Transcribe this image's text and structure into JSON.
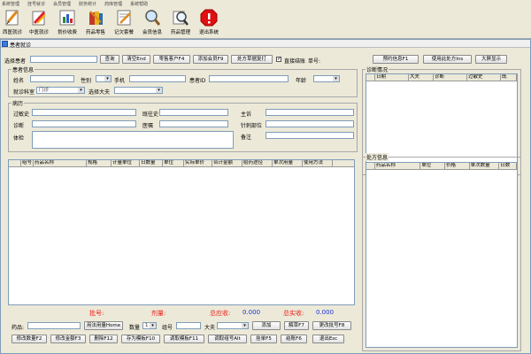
{
  "menu": [
    "系统管理",
    "挂号就诊",
    "会员管理",
    "财务统计",
    "药库管理",
    "系统帮助"
  ],
  "toolbar": [
    {
      "label": "西医就诊",
      "icon": "pencil-doc-icon"
    },
    {
      "label": "中医就诊",
      "icon": "pen-icon"
    },
    {
      "label": "划价收费",
      "icon": "chart-icon"
    },
    {
      "label": "药品零售",
      "icon": "books-icon"
    },
    {
      "label": "记欠套餐",
      "icon": "pencil-paper-icon"
    },
    {
      "label": "会员信息",
      "icon": "search-icon"
    },
    {
      "label": "药品管理",
      "icon": "magnifier-icon"
    },
    {
      "label": "退出系统",
      "icon": "exit-icon"
    }
  ],
  "window_title": "患者就诊",
  "top": {
    "select_patient": "选择患者",
    "query": "查询",
    "clear": "清空End",
    "walkin": "零售客户F4",
    "add_member": "添加会员F9",
    "prescription_tpl": "处方草据复打",
    "direct_settle": "直接结账",
    "bill_no": "单号:",
    "booking_info": "预约信息F1",
    "use_prescription": "使用此处方Ins",
    "big_screen": "大屏显示"
  },
  "patient": {
    "group": "患者信息",
    "name": "姓名",
    "gender": "性别",
    "phone": "手机",
    "patient_id": "患者ID",
    "age": "年龄",
    "dept": "就诊科室",
    "dept_value": "门诊",
    "doctor": "选择大夫"
  },
  "record": {
    "group": "病历",
    "past": "过敏史",
    "history": "既往史",
    "complaint": "主诉",
    "diagnosis": "诊断",
    "advice": "医嘱",
    "acupoint": "针刺部位",
    "exam": "体检",
    "remark": "备注"
  },
  "diag": {
    "group": "诊断情况",
    "cols": [
      "日期",
      "大夫",
      "诊断",
      "过敏史",
      "既"
    ]
  },
  "rx": {
    "group": "处方信息",
    "cols": [
      "药品名称",
      "单位",
      "价格",
      "单次数量",
      "日数"
    ]
  },
  "main_grid_cols": [
    "组号",
    "药品名称",
    "规格",
    "计量单位",
    "日数量",
    "单位",
    "实际单价",
    "合计金额",
    "给药途径",
    "单次用量",
    "使用方法"
  ],
  "bottom": {
    "batch_label": "批号:",
    "dose_label": "剂量:",
    "due_label": "总应收:",
    "due_value": "0.000",
    "paid_label": "总实收:",
    "paid_value": "0.000",
    "drug": "药品:",
    "usage_btn": "用法用量Home",
    "qty": "数量",
    "qty_val": "1",
    "group_no": "组号",
    "doctor": "大夫",
    "add": "添加",
    "decode": "解草F7",
    "change_batch": "更改批号F8",
    "b1": "修改数量F2",
    "b2": "修改金额F3",
    "b3": "删除F12",
    "b4": "存为模板F10",
    "b5": "调取模板F11",
    "b6": "调取组号Alt",
    "b7": "挂单F5",
    "b8": "结账F6",
    "b9": "退出Esc"
  }
}
